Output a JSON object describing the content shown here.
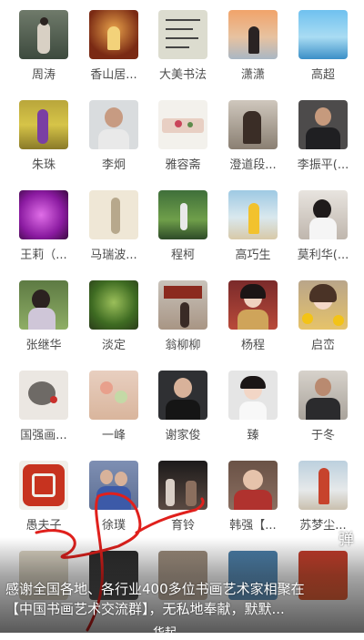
{
  "grid": {
    "rows": [
      [
        "周涛",
        "香山居...",
        "大美书法",
        "潇潇",
        "高超"
      ],
      [
        "朱珠",
        "李炯",
        "雅容斋",
        "澄道段...",
        "李振平(..."
      ],
      [
        "王莉（...",
        "马瑞波...",
        "程柯",
        "高巧生",
        "莫利华(..."
      ],
      [
        "张继华",
        "淡定",
        "翁柳柳",
        "杨程",
        "启峦"
      ],
      [
        "国强画...",
        "一峰",
        "谢家俊",
        "臻",
        "于冬"
      ],
      [
        "愚夫子",
        "徐璞",
        "育铃",
        "韩强【...",
        "苏梦尘..."
      ]
    ]
  },
  "caption": {
    "line1": "感谢全国各地、各行业400多位书画艺术家相聚在",
    "line2": "【中国书画艺术交流群】，无私地奉献，默默..."
  },
  "danmu_button": "弹",
  "partial_label": "华起"
}
